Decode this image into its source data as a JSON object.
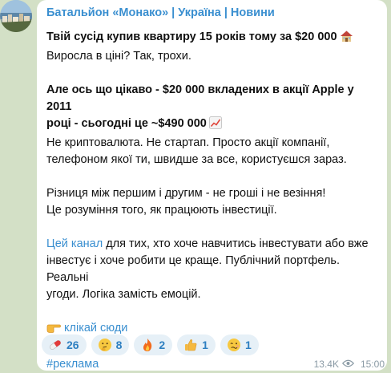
{
  "channel": {
    "name": "Батальйон «Монако» | Україна | Новини"
  },
  "message": {
    "line1": "Твій сусід купив квартиру 15 років тому за $20 000",
    "line2": "Виросла в ціні? Так, трохи.",
    "line3a": "Але ось що цікаво - $20 000 вкладених в акції Apple у 2011",
    "line3b": "році - сьогодні це ~$490 000",
    "line4": "Не криптовалюта. Не стартап. Просто акції компанії,",
    "line5": "телефоном якої ти, швидше за все, користуєшся зараз.",
    "line6": "Різниця між першим і другим - не гроші і не везіння!",
    "line7": "Це розуміння того, як працюють інвестиції.",
    "link_channel": "Цей канал",
    "line8_rest": " для тих, хто хоче навчитись інвестувати або вже",
    "line9": "інвестує і хоче робити це краще. Публічний портфель. Реальні",
    "line10": "угоди. Логіка замість емоцій.",
    "click_link": "клікай сюди",
    "hashtag": "#реклама"
  },
  "icons": {
    "house": "house-emoji",
    "chart": "chart-increasing-emoji",
    "hand": "pointing-right-emoji"
  },
  "reactions": [
    {
      "icon": "pill-emoji",
      "count": "26"
    },
    {
      "icon": "thinking-face-emoji",
      "count": "8"
    },
    {
      "icon": "fire-emoji",
      "count": "2"
    },
    {
      "icon": "thumbs-up-emoji",
      "count": "1"
    },
    {
      "icon": "woozy-face-emoji",
      "count": "1"
    }
  ],
  "meta": {
    "views": "13.4K",
    "time": "15:00"
  },
  "colors": {
    "link": "#3a8fd0",
    "background": "#d3e0c6",
    "reaction_bg": "#e6f0f7"
  }
}
